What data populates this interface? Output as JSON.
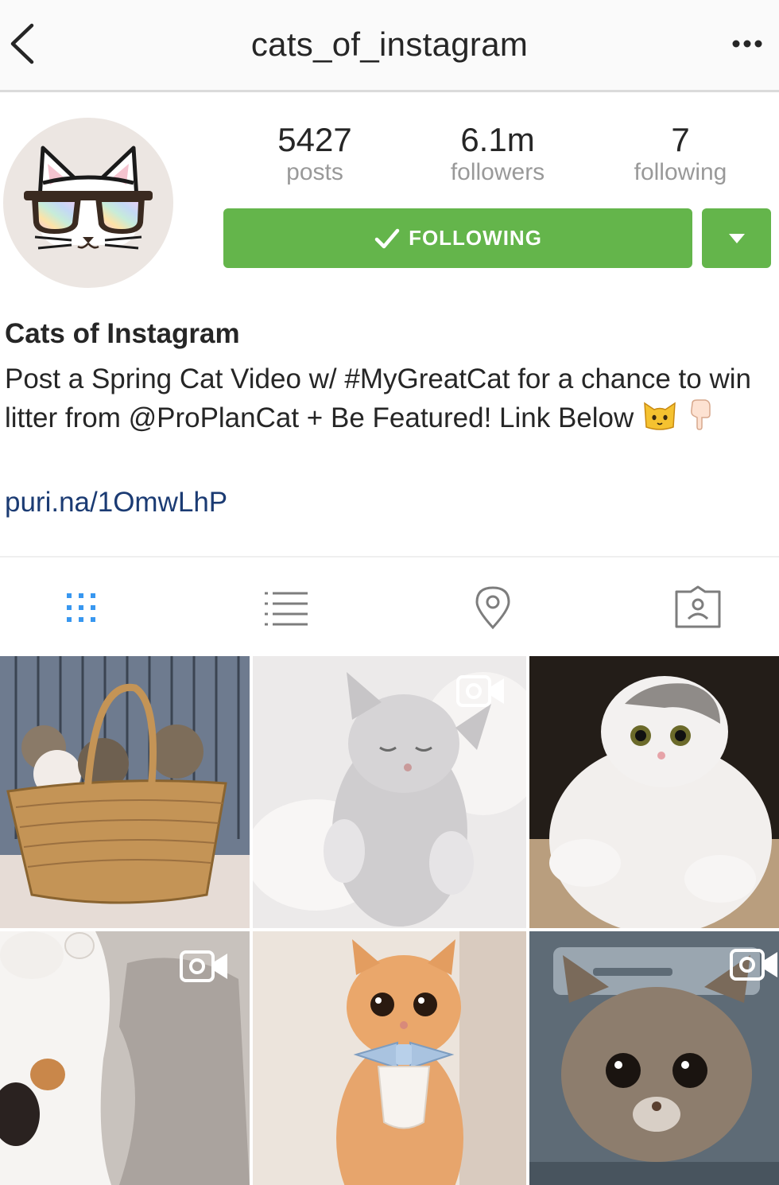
{
  "header": {
    "title": "cats_of_instagram"
  },
  "profile": {
    "stats": [
      {
        "value": "5427",
        "label": "posts"
      },
      {
        "value": "6.1m",
        "label": "followers"
      },
      {
        "value": "7",
        "label": "following"
      }
    ],
    "follow_label": "FOLLOWING",
    "name": "Cats of Instagram",
    "bio": "Post a Spring Cat Video w/ #MyGreatCat for a chance to win litter from @ProPlanCat + Be Featured! Link Below",
    "link": "puri.na/1OmwLhP"
  },
  "tabs": [
    {
      "icon": "grid-icon",
      "active": true
    },
    {
      "icon": "list-icon",
      "active": false
    },
    {
      "icon": "location-pin-icon",
      "active": false
    },
    {
      "icon": "tagged-photos-icon",
      "active": false
    }
  ],
  "posts": [
    {
      "subject": "kittens in basket",
      "is_video": false
    },
    {
      "subject": "sleeping grey kitten",
      "is_video": true
    },
    {
      "subject": "scottish fold kitten",
      "is_video": false
    },
    {
      "subject": "calico cat playing",
      "is_video": true
    },
    {
      "subject": "orange cat with bow tie",
      "is_video": false
    },
    {
      "subject": "tabby kitten in box",
      "is_video": true
    }
  ],
  "colors": {
    "follow_green": "#64b54b",
    "link_blue": "#1b3b73",
    "active_tab_blue": "#3897f0",
    "muted_gray": "#999999"
  }
}
